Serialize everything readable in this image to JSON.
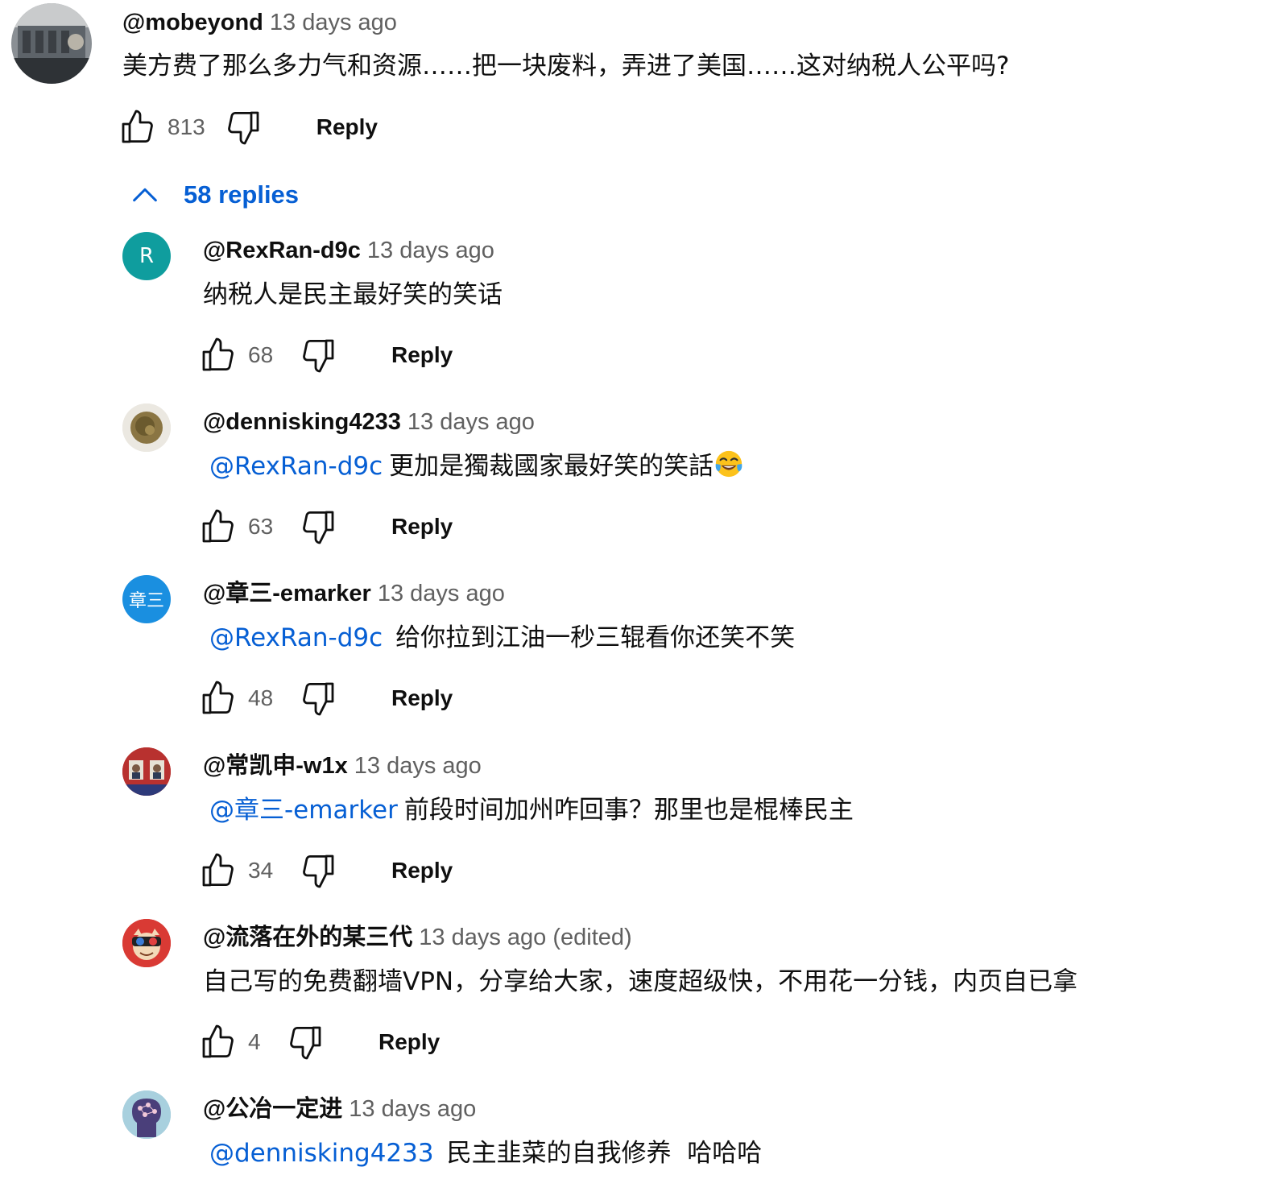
{
  "top_comment": {
    "author": "@mobeyond",
    "time": "13 days ago",
    "text": "美方费了那么多力气和资源……把一块废料，弄进了美国……这对纳税人公平吗?",
    "likes": "813",
    "reply_label": "Reply"
  },
  "replies_toggle": {
    "label": "58 replies",
    "icon": "chevron-up-icon"
  },
  "replies": [
    {
      "author": "@RexRan-d9c",
      "time": "13 days ago",
      "avatar_letter": "R",
      "avatar_color": "#0f9d9e",
      "mention": "",
      "text": "纳税人是民主最好笑的笑话",
      "likes": "68",
      "reply_label": "Reply"
    },
    {
      "author": "@dennisking4233",
      "time": "13 days ago",
      "mention": "@RexRan-d9c",
      "text": "更加是獨裁國家最好笑的笑話",
      "emoji": "tears-of-joy-emoji",
      "likes": "63",
      "reply_label": "Reply"
    },
    {
      "author": "@章三-emarker",
      "time": "13 days ago",
      "avatar_letter": "章三",
      "avatar_color": "#1a8fe0",
      "mention": "@RexRan-d9c",
      "text": "给你拉到江油一秒三辊看你还笑不笑",
      "likes": "48",
      "reply_label": "Reply"
    },
    {
      "author": "@常凯申-w1x",
      "time": "13 days ago",
      "mention": "@章三-emarker",
      "text": "前段时间加州咋回事？那里也是棍棒民主",
      "likes": "34",
      "reply_label": "Reply"
    },
    {
      "author": "@流落在外的某三代",
      "time": "13 days ago",
      "edited": "(edited)",
      "mention": "",
      "text": "自己写的免费翻墙VPN，分享给大家，速度超级快，不用花一分钱，内页自已拿",
      "likes": "4",
      "reply_label": "Reply"
    },
    {
      "author": "@公冶一定进",
      "time": "13 days ago",
      "mention": "@dennisking4233",
      "text": "民主韭菜的自我修养  哈哈哈"
    }
  ],
  "colors": {
    "link": "#065fd4",
    "meta": "#606060",
    "text": "#0f0f0f"
  }
}
